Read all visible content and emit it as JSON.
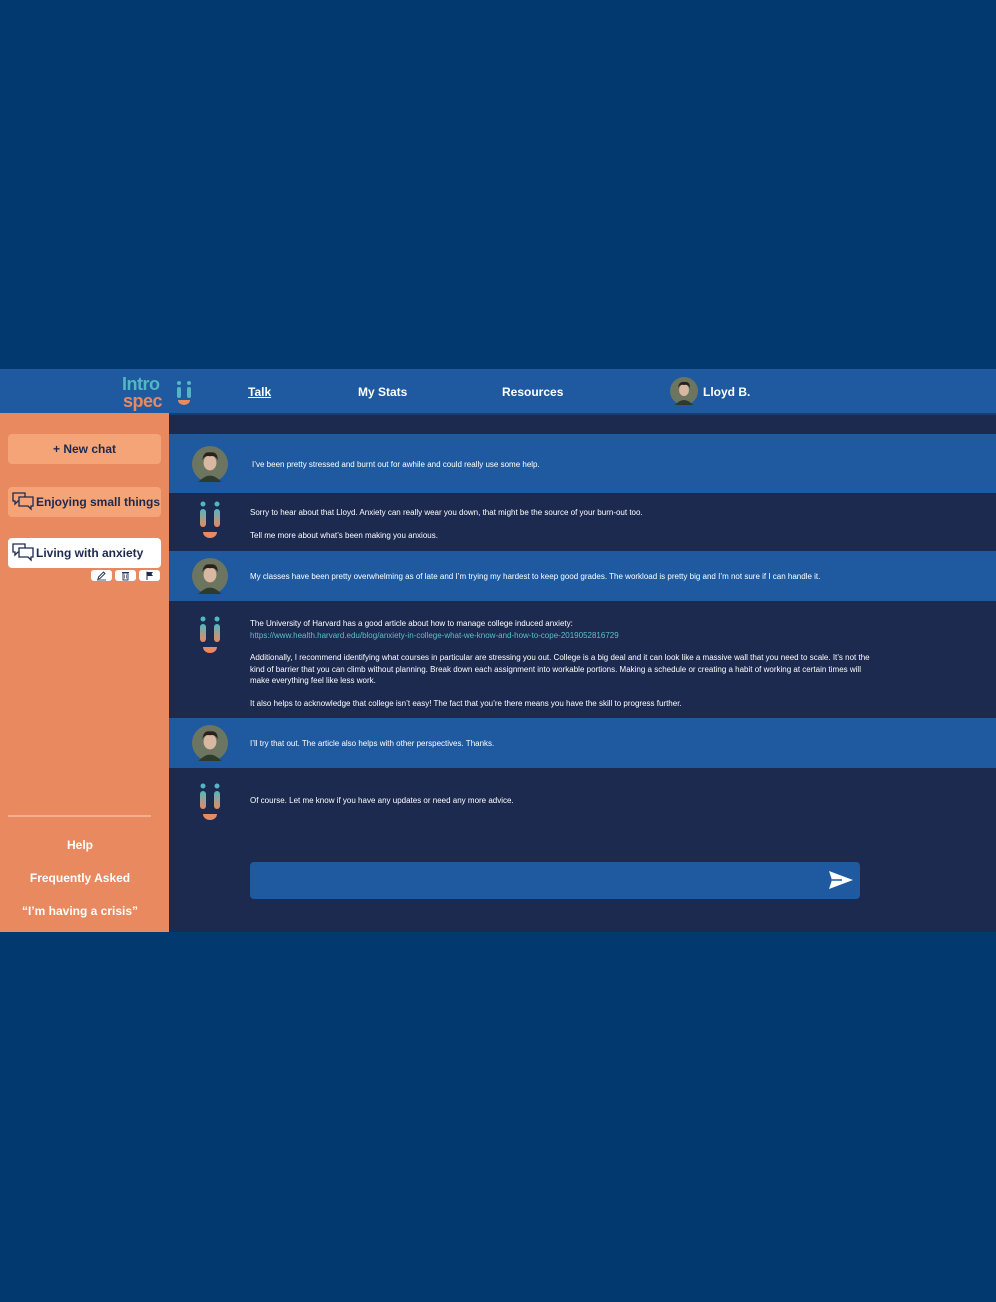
{
  "header": {
    "logo": {
      "line1": "Intro",
      "line2": "spec"
    },
    "nav": {
      "talk": "Talk",
      "stats": "My Stats",
      "resources": "Resources"
    },
    "user_name": "Lloyd B."
  },
  "sidebar": {
    "new_chat": "+ New chat",
    "chats": [
      {
        "label": "Enjoying small things"
      },
      {
        "label": "Living with anxiety"
      }
    ],
    "footer": {
      "help": "Help",
      "faq": "Frequently Asked",
      "crisis": "“I’m having a crisis”"
    }
  },
  "messages": [
    {
      "from": "user",
      "text": "I’ve been pretty stressed and burnt out for awhile and could really use some help."
    },
    {
      "from": "bot",
      "p1": "Sorry to hear about that Lloyd. Anxiety can really wear you down, that might be the source of your burn-out too.",
      "p2": "Tell me more about what’s been making you anxious."
    },
    {
      "from": "user",
      "text": "My classes have been pretty overwhelming as of late and I’m trying my hardest to keep good grades. The workload is pretty big and I’m not sure if I can handle it."
    },
    {
      "from": "bot",
      "p1": "The University of Harvard has a good article about how to manage college induced anxiety:",
      "link": "https://www.health.harvard.edu/blog/anxiety-in-college-what-we-know-and-how-to-cope-2019052816729",
      "p2": "Additionally, I recommend identifying what courses in particular are stressing you out. College is a big deal and it can look like a massive wall that you need to scale. It’s not the kind of barrier that you can climb without planning. Break down each assignment into workable portions. Making a schedule or creating a habit of working at certain times will make everything feel like less work.",
      "p3": "It also helps to acknowledge that college isn’t easy! The fact that you’re there means you have the skill to progress further."
    },
    {
      "from": "user",
      "text": "I’ll try that out. The article also helps with other perspectives. Thanks."
    },
    {
      "from": "bot",
      "text": "Of course. Let me know if you have any updates or need any more advice."
    }
  ],
  "composer": {
    "value": "",
    "placeholder": ""
  },
  "colors": {
    "page_bg": "#023a6f",
    "nav_bg": "#1f5aa0",
    "chat_bg": "#1c2a4f",
    "sidebar_bg": "#e9895f",
    "accent_teal": "#52b7c3",
    "accent_orange": "#e9895f"
  },
  "icons": {
    "logo": "introspec-logo",
    "avatar": "user-avatar",
    "bot": "bot-face-icon",
    "chat": "chat-bubbles-icon",
    "edit": "pencil-icon",
    "delete": "trash-icon",
    "flag": "flag-icon",
    "send": "send-icon"
  }
}
